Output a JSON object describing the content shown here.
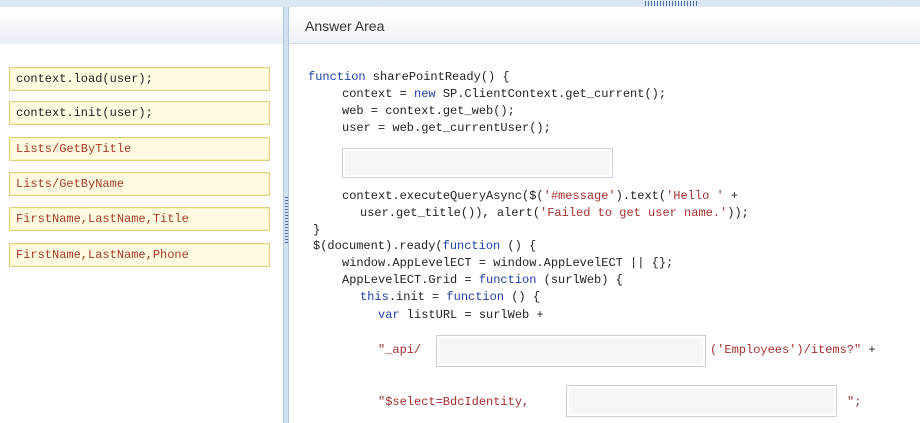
{
  "answer_area": {
    "title": "Answer Area"
  },
  "options": [
    {
      "text": "context.load(user);",
      "color": "dark"
    },
    {
      "text": "context.init(user);",
      "color": "dark"
    },
    {
      "text": "Lists/GetByTitle",
      "color": "red"
    },
    {
      "text": "Lists/GetByName",
      "color": "red"
    },
    {
      "text": "FirstName,LastName,Title",
      "color": "red"
    },
    {
      "text": "FirstName,LastName,Phone",
      "color": "red"
    }
  ],
  "code": {
    "l1_kw": "function",
    "l1_rest": " sharePointReady() {",
    "l2_a": "context = ",
    "l2_kw": "new",
    "l2_b": " SP.ClientContext.get_current();",
    "l3": "web = context.get_web();",
    "l4": "user = web.get_currentUser();",
    "l5_a": "context.executeQueryAsync($(",
    "l5_s1": "'#message'",
    "l5_b": ").text(",
    "l5_s2": "'Hello '",
    "l5_c": " +",
    "l6_a": "user.get_title()), alert(",
    "l6_s": "'Failed to get user name.'",
    "l6_b": "));",
    "l7": "}",
    "l8_a": "$(document).ready(",
    "l8_kw": "function",
    "l8_b": " () {",
    "l9": "window.AppLevelECT = window.AppLevelECT || {};",
    "l10_a": "AppLevelECT.Grid = ",
    "l10_kw": "function",
    "l10_b": " (surlWeb) {",
    "l11_kw1": "this",
    "l11_a": ".init = ",
    "l11_kw2": "function",
    "l11_b": " () {",
    "l12_kw": "var",
    "l12_rest": " listURL = surlWeb +",
    "l13_s": "\"_api/",
    "l13_s2": "('Employees')/items?\"",
    "l13_plus": " +",
    "l14_s": "\"$select=BdcIdentity,",
    "l14_s2": "\";"
  },
  "colors": {
    "keyword": "#1f3fa8",
    "string": "#a32f2f",
    "chip_bg": "#fffbe0",
    "chip_border": "#e3cf83"
  }
}
